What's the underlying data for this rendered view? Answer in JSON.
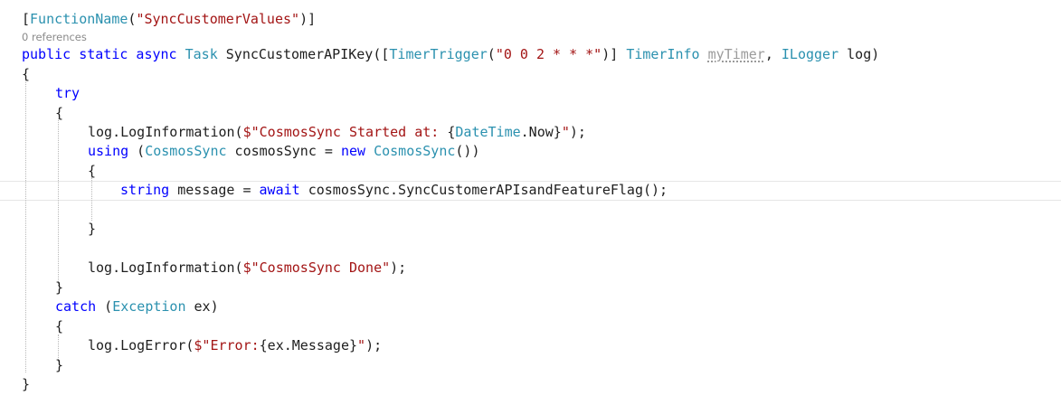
{
  "editor": {
    "attribute": {
      "open": "[",
      "name": "FunctionName",
      "paren_open": "(",
      "value": "\"SyncCustomerValues\"",
      "close": ")]"
    },
    "codelens": "0 references",
    "signature": {
      "modifiers": "public static async",
      "return_type": "Task",
      "method_name": " SyncCustomerAPIKey(",
      "bracket_open": "[",
      "trigger_attr": "TimerTrigger",
      "paren_open": "(",
      "cron": "\"0 0 2 * * *\"",
      "after_cron": ")] ",
      "timer_type": "TimerInfo",
      "timer_param": "myTimer",
      "comma": ", ",
      "logger_type": "ILogger",
      "logger_param": " log)"
    },
    "lines": {
      "open_method": "{",
      "try_kw": "try",
      "open_try": "{",
      "log1_pre": "log.LogInformation(",
      "log1_str_a": "$\"CosmosSync Started at: ",
      "log1_interp_open": "{",
      "log1_interp_type": "DateTime",
      "log1_interp_rest": ".Now}",
      "log1_str_b": "\"",
      "log1_end": ");",
      "using_kw": "using",
      "using_paren": " (",
      "using_type": "CosmosSync",
      "using_var": " cosmosSync = ",
      "new_kw": "new",
      "using_type2": "CosmosSync",
      "using_end": "())",
      "open_using": "{",
      "string_kw": "string",
      "msg_mid": " message = ",
      "await_kw": "await",
      "msg_call": " cosmosSync.SyncCustomerAPIsandFeatureFlag();",
      "close_using": "}",
      "log2_pre": "log.LogInformation(",
      "log2_str": "$\"CosmosSync Done\"",
      "log2_end": ");",
      "close_try": "}",
      "catch_kw": "catch",
      "catch_paren": " (",
      "exception_type": "Exception",
      "catch_var": " ex)",
      "open_catch": "{",
      "log3_pre": "log.LogError(",
      "log3_str_a": "$\"Error:",
      "log3_interp": "{ex.Message}",
      "log3_str_b": "\"",
      "log3_end": ");",
      "close_catch": "}",
      "close_method": "}"
    }
  },
  "colors": {
    "keyword": "#0000ff",
    "type": "#2b91af",
    "string": "#a31515",
    "text": "#1e1e1e",
    "unused_param": "#9b9b9b",
    "codelens": "#8a8a8a",
    "current_line_border": "#e6e6e6"
  }
}
